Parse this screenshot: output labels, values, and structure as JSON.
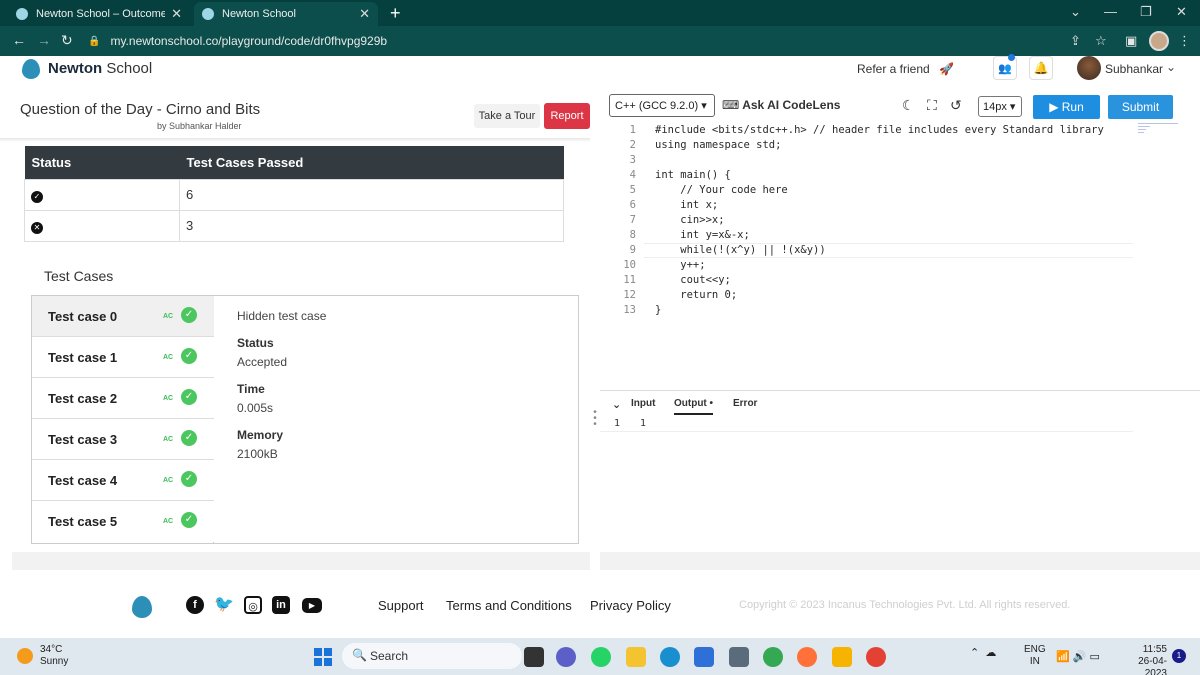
{
  "browser": {
    "tabs": [
      {
        "title": "Newton School – Outcome Orien"
      },
      {
        "title": "Newton School"
      }
    ],
    "url": "my.newtonschool.co/playground/code/dr0fhvpg929b"
  },
  "header": {
    "brand_bold": "Newton",
    "brand_rest": "School",
    "refer": "Refer a friend",
    "user": "Subhankar"
  },
  "question": {
    "title": "Question of the Day - Cirno and Bits",
    "author": "by Subhankar Halder",
    "tour_label": "Take a Tour",
    "report_label": "Report"
  },
  "status_table": {
    "headers": [
      "Status",
      "Test Cases Passed"
    ],
    "rows": [
      {
        "icon": "check-circle-icon",
        "passed": "6"
      },
      {
        "icon": "x-circle-icon",
        "passed": "3"
      }
    ]
  },
  "test_cases": {
    "heading": "Test Cases",
    "items": [
      {
        "label": "Test case 0",
        "badge": "AC"
      },
      {
        "label": "Test case 1",
        "badge": "AC"
      },
      {
        "label": "Test case 2",
        "badge": "AC"
      },
      {
        "label": "Test case 3",
        "badge": "AC"
      },
      {
        "label": "Test case 4",
        "badge": "AC"
      },
      {
        "label": "Test case 5",
        "badge": "AC"
      }
    ],
    "selected": 0,
    "detail": {
      "hidden": "Hidden test case",
      "status_key": "Status",
      "status_val": "Accepted",
      "time_key": "Time",
      "time_val": "0.005s",
      "memory_key": "Memory",
      "memory_val": "2100kB"
    }
  },
  "editor": {
    "language": "C++ (GCC 9.2.0)",
    "codelens": "Ask AI CodeLens",
    "font_size": "14px",
    "run_label": "Run",
    "submit_label": "Submit",
    "lines": [
      "#include <bits/stdc++.h> // header file includes every Standard library",
      "using namespace std;",
      "",
      "int main() {",
      "    // Your code here",
      "    int x;",
      "    cin>>x;",
      "    int y=x&-x;",
      "    while(!(x^y) || !(x&y))",
      "    y++;",
      "    cout<<y;",
      "    return 0;",
      "}"
    ],
    "line_numbers": [
      "1",
      "2",
      "3",
      "4",
      "5",
      "6",
      "7",
      "8",
      "9",
      "10",
      "11",
      "12",
      "13"
    ],
    "io_tabs": [
      "Input",
      "Output •",
      "Error"
    ],
    "active_io_tab": 1,
    "output_line_no": "1",
    "output_value": "1"
  },
  "footer": {
    "links": [
      "Support",
      "Terms and Conditions",
      "Privacy Policy"
    ],
    "copyright": "Copyright © 2023 Incanus Technologies Pvt. Ltd. All rights reserved.",
    "social": [
      "facebook-icon",
      "twitter-icon",
      "instagram-icon",
      "linkedin-icon",
      "youtube-icon"
    ]
  },
  "taskbar": {
    "temp": "34°C",
    "weather": "Sunny",
    "search": "Search",
    "lang1": "ENG",
    "lang2": "IN",
    "time": "11:55",
    "date": "26-04-2023",
    "notifications": "1"
  },
  "colors": {
    "chrome_dark": "#06403e",
    "report_red": "#dc3545",
    "run_blue": "#1e8fe0",
    "ac_green": "#4cc75f",
    "brand_blue": "#2b8fb8"
  }
}
